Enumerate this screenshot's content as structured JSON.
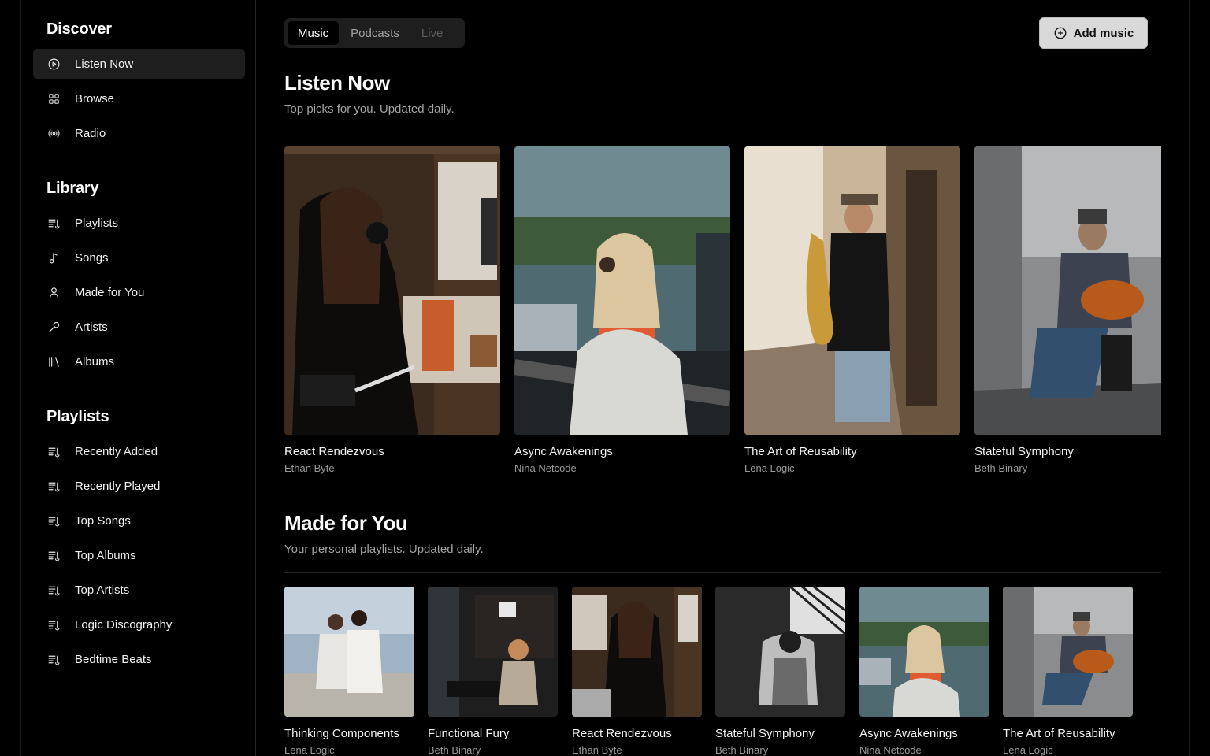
{
  "sidebar": {
    "discover": {
      "heading": "Discover",
      "items": [
        {
          "label": "Listen Now",
          "icon": "play-circle-icon"
        },
        {
          "label": "Browse",
          "icon": "grid-icon"
        },
        {
          "label": "Radio",
          "icon": "radio-icon"
        }
      ]
    },
    "library": {
      "heading": "Library",
      "items": [
        {
          "label": "Playlists",
          "icon": "playlist-icon"
        },
        {
          "label": "Songs",
          "icon": "music-note-icon"
        },
        {
          "label": "Made for You",
          "icon": "user-icon"
        },
        {
          "label": "Artists",
          "icon": "microphone-icon"
        },
        {
          "label": "Albums",
          "icon": "library-icon"
        }
      ]
    },
    "playlists": {
      "heading": "Playlists",
      "items": [
        {
          "label": "Recently Added",
          "icon": "playlist-icon"
        },
        {
          "label": "Recently Played",
          "icon": "playlist-icon"
        },
        {
          "label": "Top Songs",
          "icon": "playlist-icon"
        },
        {
          "label": "Top Albums",
          "icon": "playlist-icon"
        },
        {
          "label": "Top Artists",
          "icon": "playlist-icon"
        },
        {
          "label": "Logic Discography",
          "icon": "playlist-icon"
        },
        {
          "label": "Bedtime Beats",
          "icon": "playlist-icon"
        }
      ]
    }
  },
  "tabs": [
    {
      "label": "Music",
      "state": "active"
    },
    {
      "label": "Podcasts",
      "state": "normal"
    },
    {
      "label": "Live",
      "state": "disabled"
    }
  ],
  "add_music_label": "Add music",
  "listen_now": {
    "title": "Listen Now",
    "subtitle": "Top picks for you. Updated daily.",
    "albums": [
      {
        "title": "React Rendezvous",
        "artist": "Ethan Byte",
        "image": "woman-with-headphones-and-tablet"
      },
      {
        "title": "Async Awakenings",
        "artist": "Nina Netcode",
        "image": "blonde-woman-with-headphones"
      },
      {
        "title": "The Art of Reusability",
        "artist": "Lena Logic",
        "image": "street-saxophone-player"
      },
      {
        "title": "Stateful Symphony",
        "artist": "Beth Binary",
        "image": "street-guitarist"
      }
    ]
  },
  "made_for_you": {
    "title": "Made for You",
    "subtitle": "Your personal playlists. Updated daily.",
    "albums": [
      {
        "title": "Thinking Components",
        "artist": "Lena Logic",
        "image": "two-people-crouching-outdoors"
      },
      {
        "title": "Functional Fury",
        "artist": "Beth Binary",
        "image": "person-playing-piano"
      },
      {
        "title": "React Rendezvous",
        "artist": "Ethan Byte",
        "image": "woman-with-headphones-and-tablet"
      },
      {
        "title": "Stateful Symphony",
        "artist": "Beth Binary",
        "image": "black-and-white-woman-in-chair"
      },
      {
        "title": "Async Awakenings",
        "artist": "Nina Netcode",
        "image": "blonde-woman-with-headphones"
      },
      {
        "title": "The Art of Reusability",
        "artist": "Lena Logic",
        "image": "street-guitarist"
      }
    ]
  }
}
